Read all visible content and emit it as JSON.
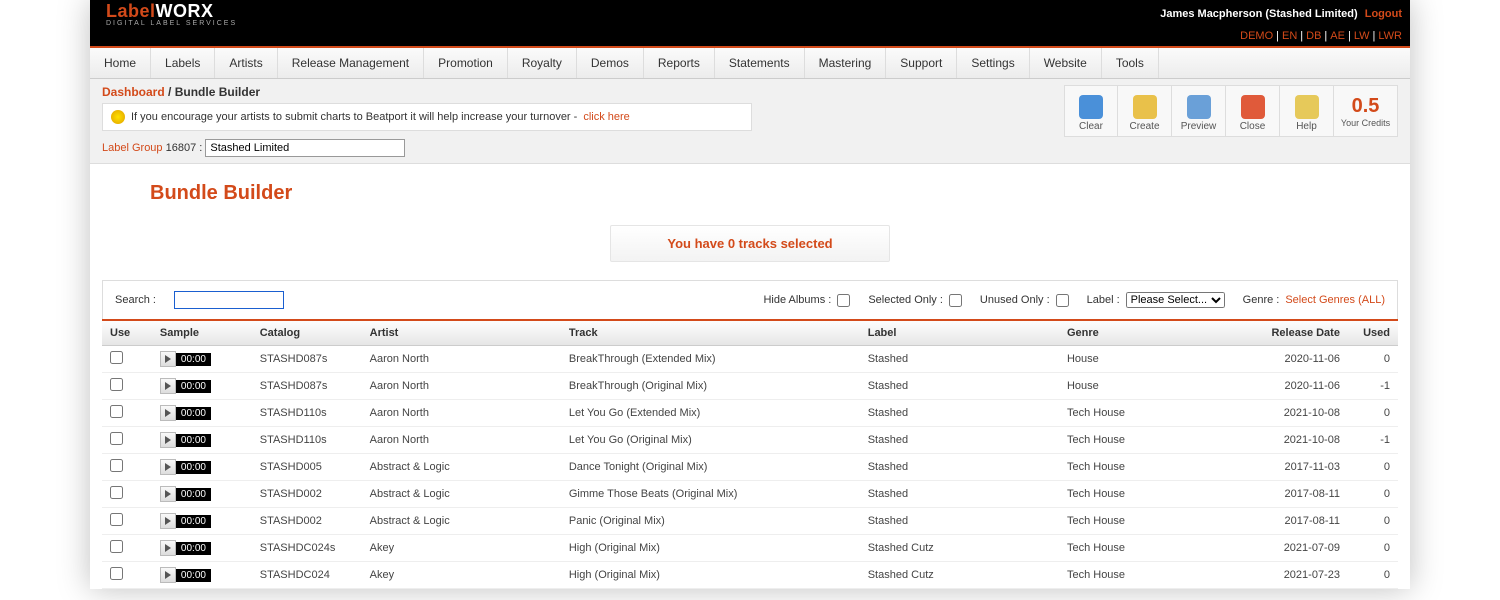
{
  "header": {
    "logo_a": "Label",
    "logo_b": "WORX",
    "logo_sub": "DIGITAL LABEL SERVICES",
    "user": "James Macpherson (Stashed Limited)",
    "logout": "Logout",
    "links": [
      "DEMO",
      "EN",
      "DB",
      "AE",
      "LW",
      "LWR"
    ]
  },
  "menu": [
    "Home",
    "Labels",
    "Artists",
    "Release Management",
    "Promotion",
    "Royalty",
    "Demos",
    "Reports",
    "Statements",
    "Mastering",
    "Support",
    "Settings",
    "Website",
    "Tools"
  ],
  "breadcrumb": {
    "a": "Dashboard",
    "sep": " / ",
    "b": "Bundle Builder"
  },
  "tip": {
    "text": "If you encourage your artists to submit charts to Beatport it will help increase your turnover - ",
    "cta": "click here"
  },
  "actions": [
    {
      "label": "Clear",
      "color": "#4a90d9"
    },
    {
      "label": "Create",
      "color": "#e9c14a"
    },
    {
      "label": "Preview",
      "color": "#6aa0d8"
    },
    {
      "label": "Close",
      "color": "#e05a3a"
    },
    {
      "label": "Help",
      "color": "#e6c95a"
    }
  ],
  "credits": {
    "value": "0.5",
    "label": "Your Credits"
  },
  "label_group": {
    "label": "Label Group",
    "id": "16807 :",
    "value": "Stashed Limited"
  },
  "page_title": "Bundle Builder",
  "banner": "You have 0 tracks selected",
  "filters": {
    "search": "Search :",
    "hide_albums": "Hide Albums :",
    "selected_only": "Selected Only :",
    "unused_only": "Unused Only :",
    "label": "Label :",
    "label_select": "Please Select...",
    "genre": "Genre :",
    "genre_link": "Select Genres (ALL)"
  },
  "columns": [
    "Use",
    "Sample",
    "Catalog",
    "Artist",
    "Track",
    "Label",
    "Genre",
    "Release Date",
    "Used"
  ],
  "rows": [
    {
      "time": "00:00",
      "catalog": "STASHD087s",
      "artist": "Aaron North",
      "track": "BreakThrough (Extended Mix)",
      "label": "Stashed",
      "genre": "House",
      "date": "2020-11-06",
      "used": "0"
    },
    {
      "time": "00:00",
      "catalog": "STASHD087s",
      "artist": "Aaron North",
      "track": "BreakThrough (Original Mix)",
      "label": "Stashed",
      "genre": "House",
      "date": "2020-11-06",
      "used": "-1"
    },
    {
      "time": "00:00",
      "catalog": "STASHD110s",
      "artist": "Aaron North",
      "track": "Let You Go (Extended Mix)",
      "label": "Stashed",
      "genre": "Tech House",
      "date": "2021-10-08",
      "used": "0"
    },
    {
      "time": "00:00",
      "catalog": "STASHD110s",
      "artist": "Aaron North",
      "track": "Let You Go (Original Mix)",
      "label": "Stashed",
      "genre": "Tech House",
      "date": "2021-10-08",
      "used": "-1"
    },
    {
      "time": "00:00",
      "catalog": "STASHD005",
      "artist": "Abstract & Logic",
      "track": "Dance Tonight (Original Mix)",
      "label": "Stashed",
      "genre": "Tech House",
      "date": "2017-11-03",
      "used": "0"
    },
    {
      "time": "00:00",
      "catalog": "STASHD002",
      "artist": "Abstract & Logic",
      "track": "Gimme Those Beats (Original Mix)",
      "label": "Stashed",
      "genre": "Tech House",
      "date": "2017-08-11",
      "used": "0"
    },
    {
      "time": "00:00",
      "catalog": "STASHD002",
      "artist": "Abstract & Logic",
      "track": "Panic (Original Mix)",
      "label": "Stashed",
      "genre": "Tech House",
      "date": "2017-08-11",
      "used": "0"
    },
    {
      "time": "00:00",
      "catalog": "STASHDC024s",
      "artist": "Akey",
      "track": "High (Original Mix)",
      "label": "Stashed Cutz",
      "genre": "Tech House",
      "date": "2021-07-09",
      "used": "0"
    },
    {
      "time": "00:00",
      "catalog": "STASHDC024",
      "artist": "Akey",
      "track": "High (Original Mix)",
      "label": "Stashed Cutz",
      "genre": "Tech House",
      "date": "2021-07-23",
      "used": "0"
    }
  ]
}
